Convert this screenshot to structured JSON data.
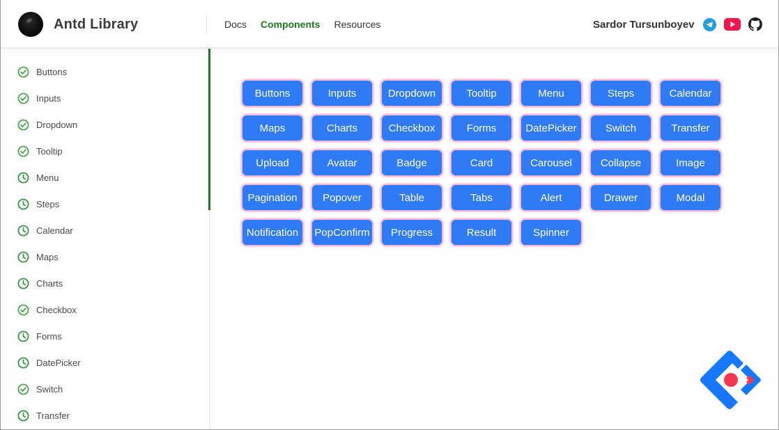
{
  "header": {
    "brand": "Antd Library",
    "nav": [
      {
        "label": "Docs",
        "active": false
      },
      {
        "label": "Components",
        "active": true
      },
      {
        "label": "Resources",
        "active": false
      }
    ],
    "author": "Sardor Tursunboyev",
    "socials": [
      "telegram-icon",
      "youtube-icon",
      "github-icon"
    ]
  },
  "sidebar": {
    "items": [
      {
        "label": "Buttons",
        "icon": "check-circle-icon"
      },
      {
        "label": "Inputs",
        "icon": "check-circle-icon"
      },
      {
        "label": "Dropdown",
        "icon": "check-circle-icon"
      },
      {
        "label": "Tooltip",
        "icon": "check-circle-icon"
      },
      {
        "label": "Menu",
        "icon": "clock-icon"
      },
      {
        "label": "Steps",
        "icon": "clock-icon"
      },
      {
        "label": "Calendar",
        "icon": "clock-icon"
      },
      {
        "label": "Maps",
        "icon": "clock-icon"
      },
      {
        "label": "Charts",
        "icon": "clock-icon"
      },
      {
        "label": "Checkbox",
        "icon": "check-circle-icon"
      },
      {
        "label": "Forms",
        "icon": "clock-icon"
      },
      {
        "label": "DatePicker",
        "icon": "clock-icon"
      },
      {
        "label": "Switch",
        "icon": "check-circle-icon"
      },
      {
        "label": "Transfer",
        "icon": "clock-icon"
      }
    ]
  },
  "components": [
    "Buttons",
    "Inputs",
    "Dropdown",
    "Tooltip",
    "Menu",
    "Steps",
    "Calendar",
    "Maps",
    "Charts",
    "Checkbox",
    "Forms",
    "DatePicker",
    "Switch",
    "Transfer",
    "Upload",
    "Avatar",
    "Badge",
    "Card",
    "Carousel",
    "Collapse",
    "Image",
    "Pagination",
    "Popover",
    "Table",
    "Tabs",
    "Alert",
    "Drawer",
    "Modal",
    "Notification",
    "PopConfirm",
    "Progress",
    "Result",
    "Spinner"
  ],
  "colors": {
    "accent": "#1f7a1f",
    "button_bg": "#2f7bf6",
    "button_border": "#f3b8d9"
  }
}
